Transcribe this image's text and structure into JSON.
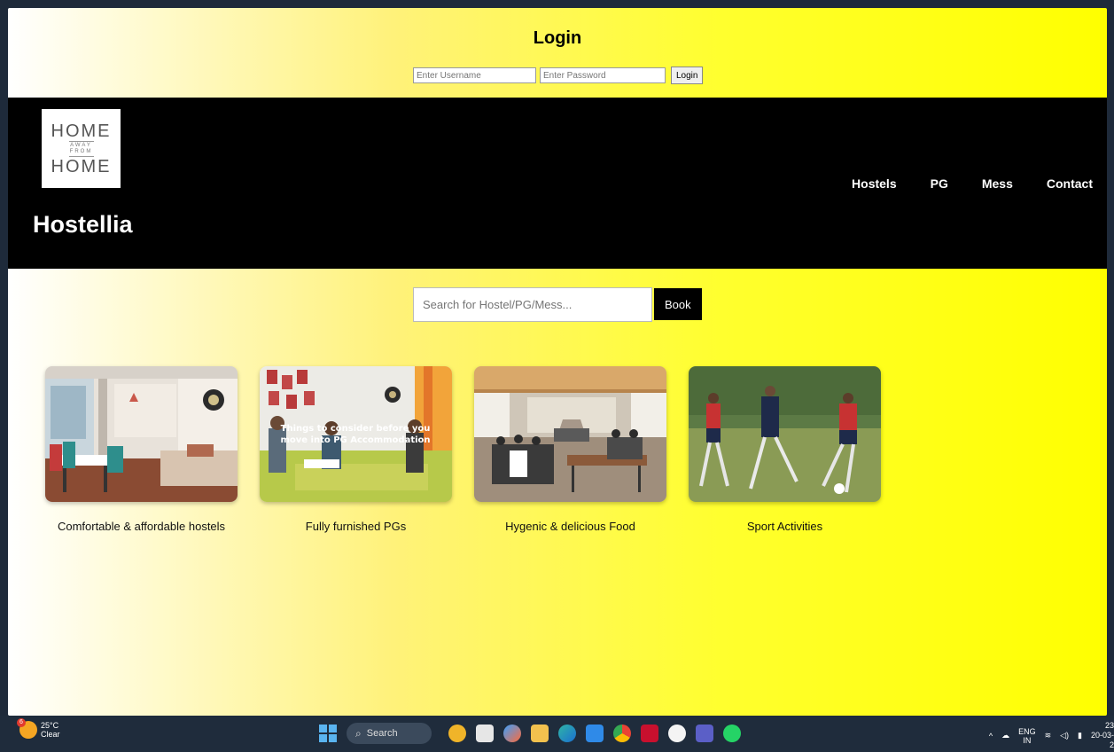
{
  "login": {
    "title": "Login",
    "username_placeholder": "Enter Username",
    "password_placeholder": "Enter Password",
    "button_label": "Login"
  },
  "header": {
    "logo": {
      "line1": "HOME",
      "line2": "AWAY",
      "line3": "FROM",
      "line4": "HOME"
    },
    "brand": "Hostellia",
    "nav": [
      "Hostels",
      "PG",
      "Mess",
      "Contact"
    ]
  },
  "search": {
    "placeholder": "Search for Hostel/PG/Mess...",
    "button_label": "Book"
  },
  "cards": [
    {
      "caption": "Comfortable & affordable hostels",
      "image": "hostel-room-photo"
    },
    {
      "caption": "Fully furnished PGs",
      "image": "pg-common-room-photo",
      "overlay": "Things to consider before you move into PG Accommodation"
    },
    {
      "caption": "Hygenic & delicious Food",
      "image": "mess-hall-photo"
    },
    {
      "caption": "Sport Activities",
      "image": "football-players-photo"
    }
  ],
  "taskbar": {
    "weather_temp": "25°C",
    "weather_cond": "Clear",
    "weather_badge": "6",
    "search_label": "Search",
    "lang_line1": "ENG",
    "lang_line2": "IN",
    "time": "23",
    "date": "20-03-2"
  },
  "colors": {
    "header_bg": "#000000",
    "accent_yellow": "#ffff00",
    "taskbar_bg": "#1f2c3c"
  }
}
